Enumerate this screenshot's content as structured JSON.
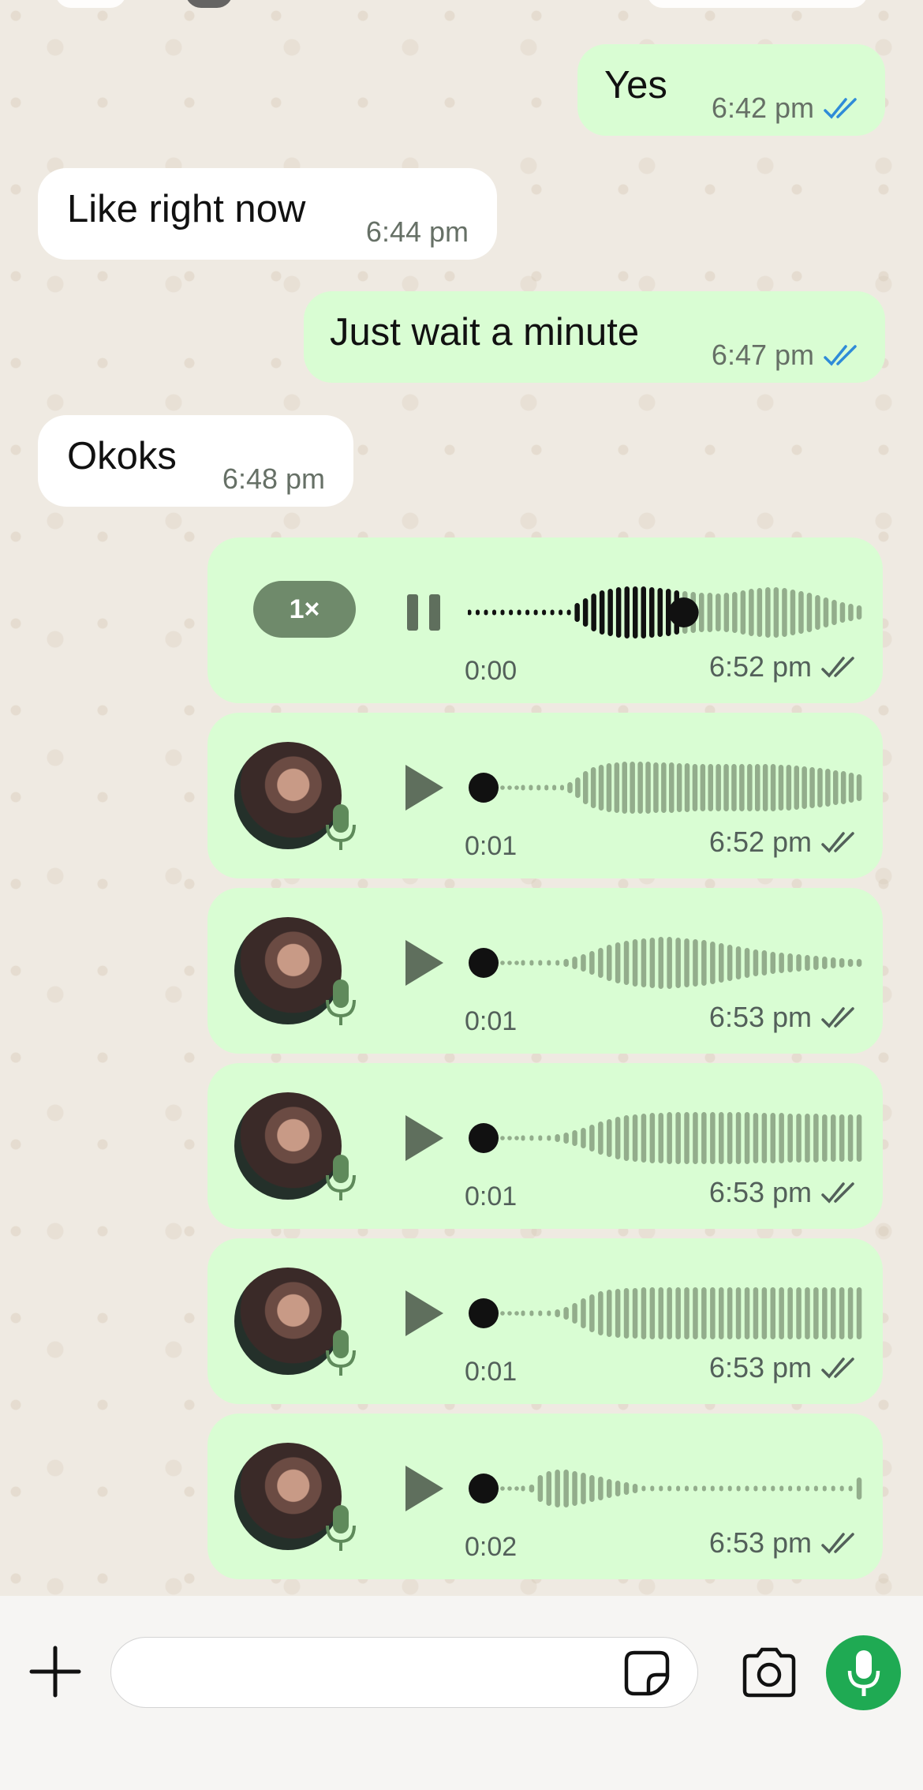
{
  "colors": {
    "outgoing_bubble": "#d9fdd3",
    "incoming_bubble": "#ffffff",
    "read_tick_blue": "#2f8bd8",
    "delivered_tick_gray": "#53605a",
    "mic_button_green": "#1faa53",
    "speed_pill": "#6f8a6b"
  },
  "messages": [
    {
      "direction": "out",
      "text": "Yes",
      "time": "6:42 pm",
      "status_icon": "double-check-blue-icon"
    },
    {
      "direction": "in",
      "text": "Like right now",
      "time": "6:44 pm"
    },
    {
      "direction": "out",
      "text": "Just wait a minute",
      "time": "6:47 pm",
      "status_icon": "double-check-blue-icon"
    },
    {
      "direction": "in",
      "text": "Okoks",
      "time": "6:48 pm"
    }
  ],
  "voice_notes": [
    {
      "state": "playing",
      "speed": "1×",
      "duration": "0:00",
      "time": "6:52 pm",
      "progress": 0.55,
      "status_icon": "double-check-gray-icon"
    },
    {
      "state": "paused",
      "duration": "0:01",
      "time": "6:52 pm",
      "progress": 0.0,
      "status_icon": "double-check-gray-icon"
    },
    {
      "state": "paused",
      "duration": "0:01",
      "time": "6:53 pm",
      "progress": 0.0,
      "status_icon": "double-check-gray-icon"
    },
    {
      "state": "paused",
      "duration": "0:01",
      "time": "6:53 pm",
      "progress": 0.0,
      "status_icon": "double-check-gray-icon"
    },
    {
      "state": "paused",
      "duration": "0:01",
      "time": "6:53 pm",
      "progress": 0.0,
      "status_icon": "double-check-gray-icon"
    },
    {
      "state": "paused",
      "duration": "0:02",
      "time": "6:53 pm",
      "progress": 0.0,
      "status_icon": "double-check-gray-icon"
    }
  ],
  "composer": {
    "input_value": "",
    "input_placeholder": "",
    "icons": [
      "plus-icon",
      "sticker-icon",
      "camera-icon",
      "microphone-icon"
    ]
  }
}
